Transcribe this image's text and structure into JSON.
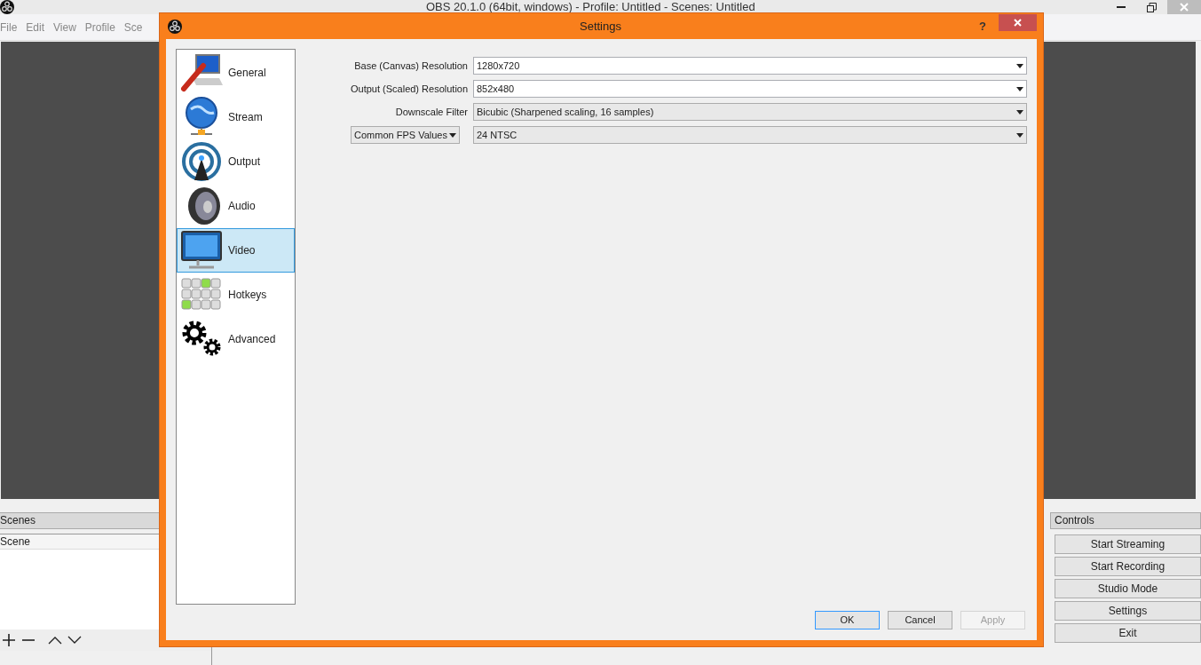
{
  "main_window": {
    "title": "OBS 20.1.0 (64bit, windows) - Profile: Untitled - Scenes: Untitled",
    "menu": [
      "File",
      "Edit",
      "View",
      "Profile",
      "Sce"
    ],
    "scenes_dock": {
      "title": "Scenes",
      "items": [
        "Scene"
      ]
    },
    "controls_dock": {
      "title": "Controls",
      "buttons": [
        "Start Streaming",
        "Start Recording",
        "Studio Mode",
        "Settings",
        "Exit"
      ]
    }
  },
  "dialog": {
    "title": "Settings",
    "help": "?",
    "categories": [
      {
        "kind": "general",
        "label": "General",
        "selected": false
      },
      {
        "kind": "stream",
        "label": "Stream",
        "selected": false
      },
      {
        "kind": "output",
        "label": "Output",
        "selected": false
      },
      {
        "kind": "audio",
        "label": "Audio",
        "selected": false
      },
      {
        "kind": "video",
        "label": "Video",
        "selected": true
      },
      {
        "kind": "hotkeys",
        "label": "Hotkeys",
        "selected": false
      },
      {
        "kind": "advanced",
        "label": "Advanced",
        "selected": false
      }
    ],
    "fields": [
      {
        "kind": "label",
        "label": "Base (Canvas) Resolution",
        "value": "1280x720",
        "editable": true
      },
      {
        "kind": "label",
        "label": "Output (Scaled) Resolution",
        "value": "852x480",
        "editable": true
      },
      {
        "kind": "label",
        "label": "Downscale Filter",
        "value": "Bicubic (Sharpened scaling, 16 samples)",
        "editable": false
      },
      {
        "kind": "dropdown",
        "label": "Common FPS Values",
        "value": "24 NTSC",
        "editable": false
      }
    ],
    "buttons": [
      {
        "label": "OK",
        "default": true,
        "disabled": false
      },
      {
        "label": "Cancel",
        "default": false,
        "disabled": false
      },
      {
        "label": "Apply",
        "default": false,
        "disabled": true
      }
    ]
  }
}
